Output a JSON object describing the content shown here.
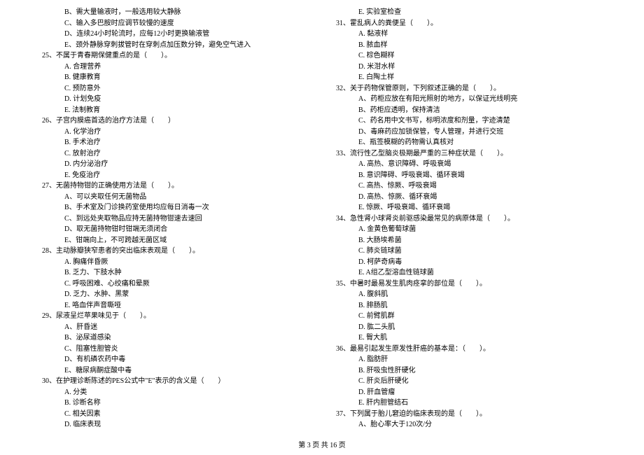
{
  "left_column": [
    {
      "type": "option",
      "text": "B、需大量输液时，一般选用较大静脉"
    },
    {
      "type": "option",
      "text": "C、输入多巴胺时应调节较慢的速度"
    },
    {
      "type": "option",
      "text": "D、连续24小时轮流时，应每12小时更换输液管"
    },
    {
      "type": "option",
      "text": "E、颈外静脉穿刺拔管时在穿刺点加压数分钟，避免空气进入"
    },
    {
      "type": "question",
      "text": "25、不属于青春期保健重点的是（　　）。"
    },
    {
      "type": "option",
      "text": "A. 合理营养"
    },
    {
      "type": "option",
      "text": "B. 健康教育"
    },
    {
      "type": "option",
      "text": "C. 预防意外"
    },
    {
      "type": "option",
      "text": "D. 计划免疫"
    },
    {
      "type": "option",
      "text": "E. 法制教育"
    },
    {
      "type": "question",
      "text": "26、子宫内膜癌首选的治疗方法是（　　）"
    },
    {
      "type": "option",
      "text": "A. 化学治疗"
    },
    {
      "type": "option",
      "text": "B. 手术治疗"
    },
    {
      "type": "option",
      "text": "C. 放射治疗"
    },
    {
      "type": "option",
      "text": "D. 内分泌治疗"
    },
    {
      "type": "option",
      "text": "E. 免疫治疗"
    },
    {
      "type": "question",
      "text": "27、无菌持物钳的正确使用方法是（　　）。"
    },
    {
      "type": "option",
      "text": "A、可以夹取任何无菌物品"
    },
    {
      "type": "option",
      "text": "B、手术室及门诊换药室使用均应每日消毒一次"
    },
    {
      "type": "option",
      "text": "C、到远处夹取物品应持无菌持物钳速去速回"
    },
    {
      "type": "option",
      "text": "D、取无菌持物钳时钳端无须闭合"
    },
    {
      "type": "option",
      "text": "E、钳端向上，不可跨越无菌区域"
    },
    {
      "type": "question",
      "text": "28、主动脉瓣狭窄患者的突出临床表观是（　　）。"
    },
    {
      "type": "option",
      "text": "A. 胸痛伴昏厥"
    },
    {
      "type": "option",
      "text": "B. 乏力、下肢水肿"
    },
    {
      "type": "option",
      "text": "C. 呼吸困难、心绞痛和晕厥"
    },
    {
      "type": "option",
      "text": "D. 乏力、水肿、黑蒙"
    },
    {
      "type": "option",
      "text": "E. 咯血伴声音嘶哑"
    },
    {
      "type": "question",
      "text": "29、尿液呈烂苹果味见于（　　）。"
    },
    {
      "type": "option",
      "text": "A、肝昏迷"
    },
    {
      "type": "option",
      "text": "B、泌尿道感染"
    },
    {
      "type": "option",
      "text": "C、阻塞性胆管炎"
    },
    {
      "type": "option",
      "text": "D、有机磷农药中毒"
    },
    {
      "type": "option",
      "text": "E、糖尿病酮症酸中毒"
    },
    {
      "type": "question",
      "text": "30、在护理诊断陈述的PES公式中\"E\"表示的含义是（　　）"
    },
    {
      "type": "option",
      "text": "A. 分类"
    },
    {
      "type": "option",
      "text": "B. 诊断名称"
    },
    {
      "type": "option",
      "text": "C. 相关因素"
    },
    {
      "type": "option",
      "text": "D. 临床表现"
    }
  ],
  "right_column": [
    {
      "type": "option",
      "text": "E. 实验室检查"
    },
    {
      "type": "question",
      "text": "31、霍乱病人的粪便呈（　　）。"
    },
    {
      "type": "option",
      "text": "A. 黏液样"
    },
    {
      "type": "option",
      "text": "B. 脓血样"
    },
    {
      "type": "option",
      "text": "C. 棕色糊样"
    },
    {
      "type": "option",
      "text": "D. 米泔水样"
    },
    {
      "type": "option",
      "text": "E. 白陶土样"
    },
    {
      "type": "question",
      "text": "32、关于药物保管原则，下列叙述正确的是（　　）。"
    },
    {
      "type": "option",
      "text": "A、药柜应放在有阳光照射的地方，以保证光线明亮"
    },
    {
      "type": "option",
      "text": "B、药柜应透明，保持清洁"
    },
    {
      "type": "option",
      "text": "C、药名用中文书写，标明浓度和剂量，字迹清楚"
    },
    {
      "type": "option",
      "text": "D、毒麻药应加锁保管，专人管理，并进行交班"
    },
    {
      "type": "option",
      "text": "E、瓶签模糊的药物需认真核对"
    },
    {
      "type": "question",
      "text": "33、流行性乙型脑炎极期最严重的三种症状是（　　）。"
    },
    {
      "type": "option",
      "text": "A. 高热、意识障碍、呼吸衰竭"
    },
    {
      "type": "option",
      "text": "B. 意识障碍、呼吸衰竭、循环衰竭"
    },
    {
      "type": "option",
      "text": "C. 高热、惊厥、呼吸衰竭"
    },
    {
      "type": "option",
      "text": "D. 高热、惊厥、循环衰竭"
    },
    {
      "type": "option",
      "text": "E. 惊厥、呼吸衰竭、循环衰竭"
    },
    {
      "type": "question",
      "text": "34、急性肾小球肾炎前驱感染最常见的病原体是（　　）。"
    },
    {
      "type": "option",
      "text": "A. 金黄色葡萄球菌"
    },
    {
      "type": "option",
      "text": "B. 大肠埃希菌"
    },
    {
      "type": "option",
      "text": "C. 肺炎链球菌"
    },
    {
      "type": "option",
      "text": "D. 柯萨奇病毒"
    },
    {
      "type": "option",
      "text": "E. A组乙型溶血性链球菌"
    },
    {
      "type": "question",
      "text": "35、中暑时最易发生肌肉痉挛的部位是（　　）。"
    },
    {
      "type": "option",
      "text": "A. 腹斜肌"
    },
    {
      "type": "option",
      "text": "B. 腓肠肌"
    },
    {
      "type": "option",
      "text": "C. 前臂肌群"
    },
    {
      "type": "option",
      "text": "D. 肱二头肌"
    },
    {
      "type": "option",
      "text": "E. 臀大肌"
    },
    {
      "type": "question",
      "text": "36、最易引起发生原发性肝癌的基本是：（　　）。"
    },
    {
      "type": "option",
      "text": "A. 脂肪肝"
    },
    {
      "type": "option",
      "text": "B. 肝吸虫性肝硬化"
    },
    {
      "type": "option",
      "text": "C. 肝炎后肝硬化"
    },
    {
      "type": "option",
      "text": "D. 肝血管瘤"
    },
    {
      "type": "option",
      "text": "E. 肝内胆管结石"
    },
    {
      "type": "question",
      "text": "37、下列属于胎儿窘迫的临床表现的是（　　）。"
    },
    {
      "type": "option",
      "text": "A、胎心率大于120次/分"
    }
  ],
  "footer": "第 3 页 共 16 页"
}
